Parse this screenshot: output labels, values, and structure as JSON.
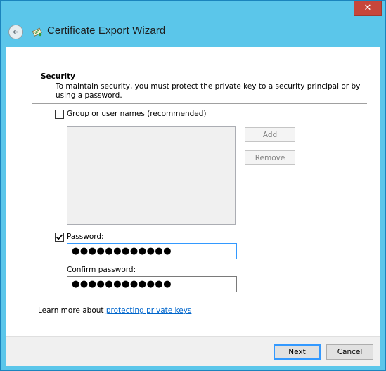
{
  "window": {
    "close_label": "✕"
  },
  "header": {
    "title": "Certificate Export Wizard"
  },
  "security": {
    "heading": "Security",
    "description": "To maintain security, you must protect the private key to a security principal or by using a password.",
    "group_option": {
      "label": "Group or user names (recommended)",
      "checked": false
    },
    "add_label": "Add",
    "remove_label": "Remove",
    "password_option": {
      "label": "Password:",
      "checked": true
    },
    "password_value": "●●●●●●●●●●●●",
    "confirm_label": "Confirm password:",
    "confirm_value": "●●●●●●●●●●●●"
  },
  "learn_more": {
    "prefix": "Learn more about ",
    "link": "protecting private keys"
  },
  "footer": {
    "next_label": "Next",
    "cancel_label": "Cancel"
  },
  "colors": {
    "frame": "#5bc6ea",
    "close": "#c7463b",
    "link": "#0066cc"
  },
  "icons": [
    "close-icon",
    "back-arrow-icon",
    "certificate-icon",
    "checkmark-icon"
  ]
}
